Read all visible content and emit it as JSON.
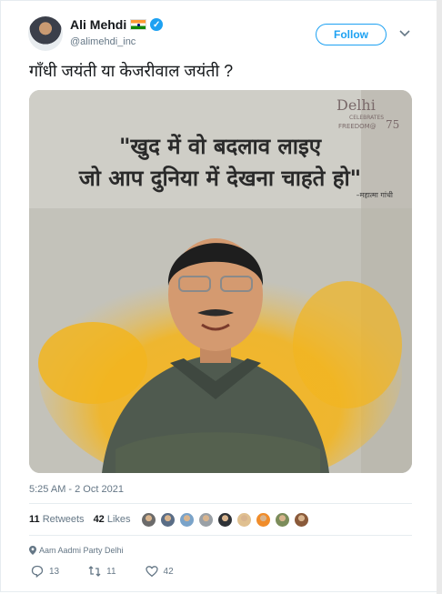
{
  "author": {
    "name": "Ali Mehdi",
    "handle": "@alimehdi_inc",
    "verified": true
  },
  "follow_label": "Follow",
  "tweet_text": "गाँधी जयंती या केजरीवाल जयंती ?",
  "media": {
    "quote_line1": "\"खुद में वो बदलाव लाइए",
    "quote_line2": "जो आप दुनिया में देखना चाहते हो\"",
    "attribution": "–महात्मा गांधी",
    "logo_text": "Delhi",
    "logo_sub1": "CELEBRATES",
    "logo_sub2": "FREEDOM@",
    "logo_num": "75"
  },
  "timestamp": "5:25 AM - 2 Oct 2021",
  "stats": {
    "retweets_count": "11",
    "retweets_label": "Retweets",
    "likes_count": "42",
    "likes_label": "Likes"
  },
  "liker_colors": [
    "#6b6b6b",
    "#5a6d86",
    "#7aa3c9",
    "#9aa0a6",
    "#2f3237",
    "#e0c090",
    "#f08c2a",
    "#7b8c5a",
    "#8a5a3a"
  ],
  "location": "Aam Aadmi Party Delhi",
  "actions": {
    "reply_count": "13",
    "retweet_count": "11",
    "like_count": "42"
  },
  "colors": {
    "accent": "#1da1f2",
    "muted": "#657786"
  }
}
